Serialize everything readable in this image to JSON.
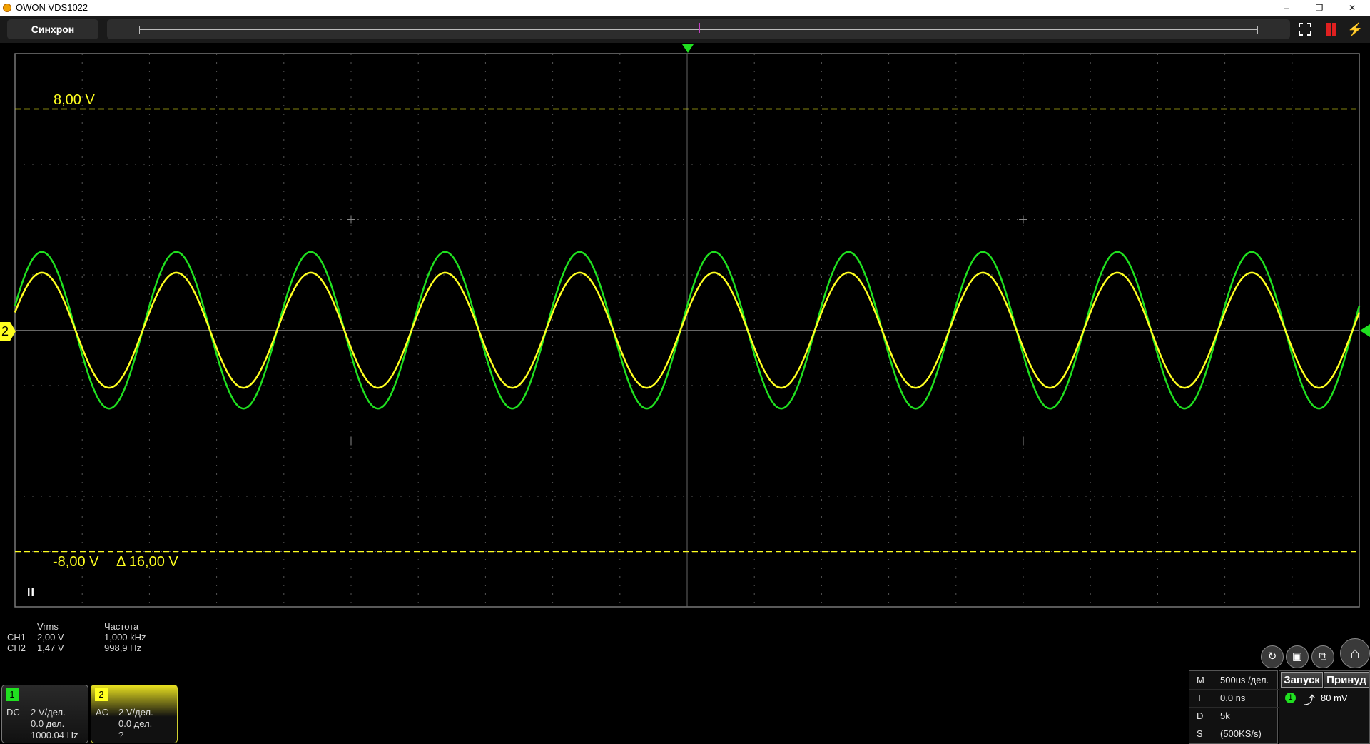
{
  "window": {
    "title": "OWON VDS1022",
    "min": "–",
    "max": "❐",
    "close": "✕"
  },
  "toolbar": {
    "sync_label": "Синхрон",
    "pause_icon": "pause-icon",
    "bolt_icon": "⚡"
  },
  "scope": {
    "grid": {
      "h_divs": 20,
      "v_divs": 10
    },
    "colors": {
      "ch1": "#20e020",
      "ch2": "#ffff20",
      "grid": "#555555"
    },
    "cursors": {
      "top_label": "8,00 V",
      "bottom_label": "-8,00 V",
      "delta_label": "Δ 16,00 V",
      "top_volts": 8,
      "bottom_volts": -8
    },
    "run_state": "II",
    "ch2_marker": "2",
    "waveforms": {
      "cycles": 10,
      "ch1": {
        "amplitude_v": 2.83,
        "rms": "2,00 V",
        "freq": "1,000 kHz"
      },
      "ch2": {
        "amplitude_v": 2.08,
        "rms": "1,47 V",
        "freq": "998,9 Hz"
      }
    }
  },
  "measurements": {
    "headers": [
      "Vrms",
      "Частота"
    ],
    "rows": [
      {
        "ch": "CH1",
        "vrms": "2,00 V",
        "freq": "1,000 kHz"
      },
      {
        "ch": "CH2",
        "vrms": "1,47 V",
        "freq": "998,9 Hz"
      }
    ]
  },
  "channels": [
    {
      "num": "1",
      "coupling": "DC",
      "scale": "2 V/дел.",
      "offset": "0.0 дел.",
      "freq": "1000.04 Hz"
    },
    {
      "num": "2",
      "coupling": "AC",
      "scale": "2 V/дел.",
      "offset": "0.0 дел.",
      "freq": "?"
    }
  ],
  "timebase": [
    {
      "k": "M",
      "v": "500us /дел."
    },
    {
      "k": "T",
      "v": "0.0 ns"
    },
    {
      "k": "D",
      "v": "5k"
    },
    {
      "k": "S",
      "v": "(500KS/s)"
    }
  ],
  "trigger": {
    "start": "Запуск",
    "force": "Принуд",
    "source": "1",
    "edge": "⤴",
    "level": "80 mV"
  },
  "buttons": {
    "auto_icon": "↻",
    "save_icon": "▣",
    "window_icon": "⧉",
    "home_icon": "⌂"
  }
}
